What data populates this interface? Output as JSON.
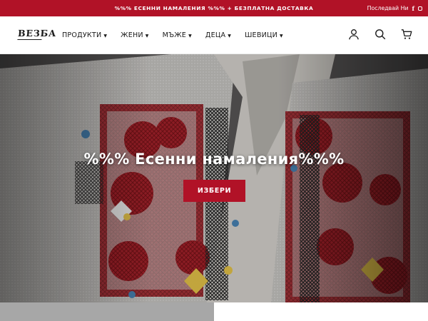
{
  "announcement": {
    "text": "%%% ЕСЕННИ НАМАЛЕНИЯ %%% + БЕЗПЛАТНА ДОСТАВКА",
    "follow_label": "Последвай Ни",
    "social_icons": [
      "facebook-icon",
      "instagram-icon"
    ],
    "background": "#b11227"
  },
  "header": {
    "logo": "ВЕЗБА",
    "nav": [
      {
        "label": "ПРОДУКТИ"
      },
      {
        "label": "ЖЕНИ"
      },
      {
        "label": "МЪЖЕ"
      },
      {
        "label": "ДЕЦА"
      },
      {
        "label": "ШЕВИЦИ"
      }
    ],
    "icons": [
      "account-icon",
      "search-icon",
      "cart-icon"
    ]
  },
  "hero": {
    "title": "%%% Есенни намаления%%%",
    "button_label": "ИЗБЕРИ",
    "accent": "#b11227"
  }
}
